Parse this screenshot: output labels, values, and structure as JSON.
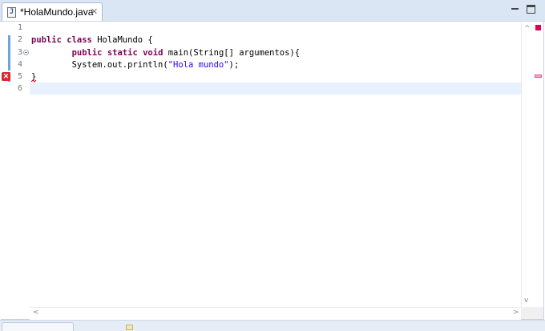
{
  "tab": {
    "title": "*HolaMundo.java",
    "file_icon_glyph": "J",
    "close_glyph": "✕"
  },
  "gutter": {
    "line_numbers": [
      "1",
      "2",
      "3",
      "4",
      "5",
      "6"
    ]
  },
  "code": {
    "line2": {
      "kw1": "public",
      "kw2": "class",
      "rest": " HolaMundo {"
    },
    "line3": {
      "indent": "        ",
      "kw1": "public",
      "kw2": "static",
      "kw3": "void",
      "rest": " main(String[] argumentos){"
    },
    "line4": {
      "indent": "        ",
      "pre": "System.out.println(",
      "str": "\"Hola mundo\"",
      "post": ");"
    },
    "line5": {
      "text": "}"
    }
  },
  "icons": {
    "error": "error-icon",
    "fold": "fold-collapse-icon",
    "minimize": "minimize-icon",
    "maximize": "maximize-icon"
  },
  "scroll": {
    "up_glyph": "^",
    "down_glyph": "v",
    "left_glyph": "<",
    "right_glyph": ">"
  },
  "colors": {
    "keyword": "#7f0055",
    "string": "#2a00ff",
    "error": "#d8262e",
    "current_line": "#e8f2fe"
  }
}
